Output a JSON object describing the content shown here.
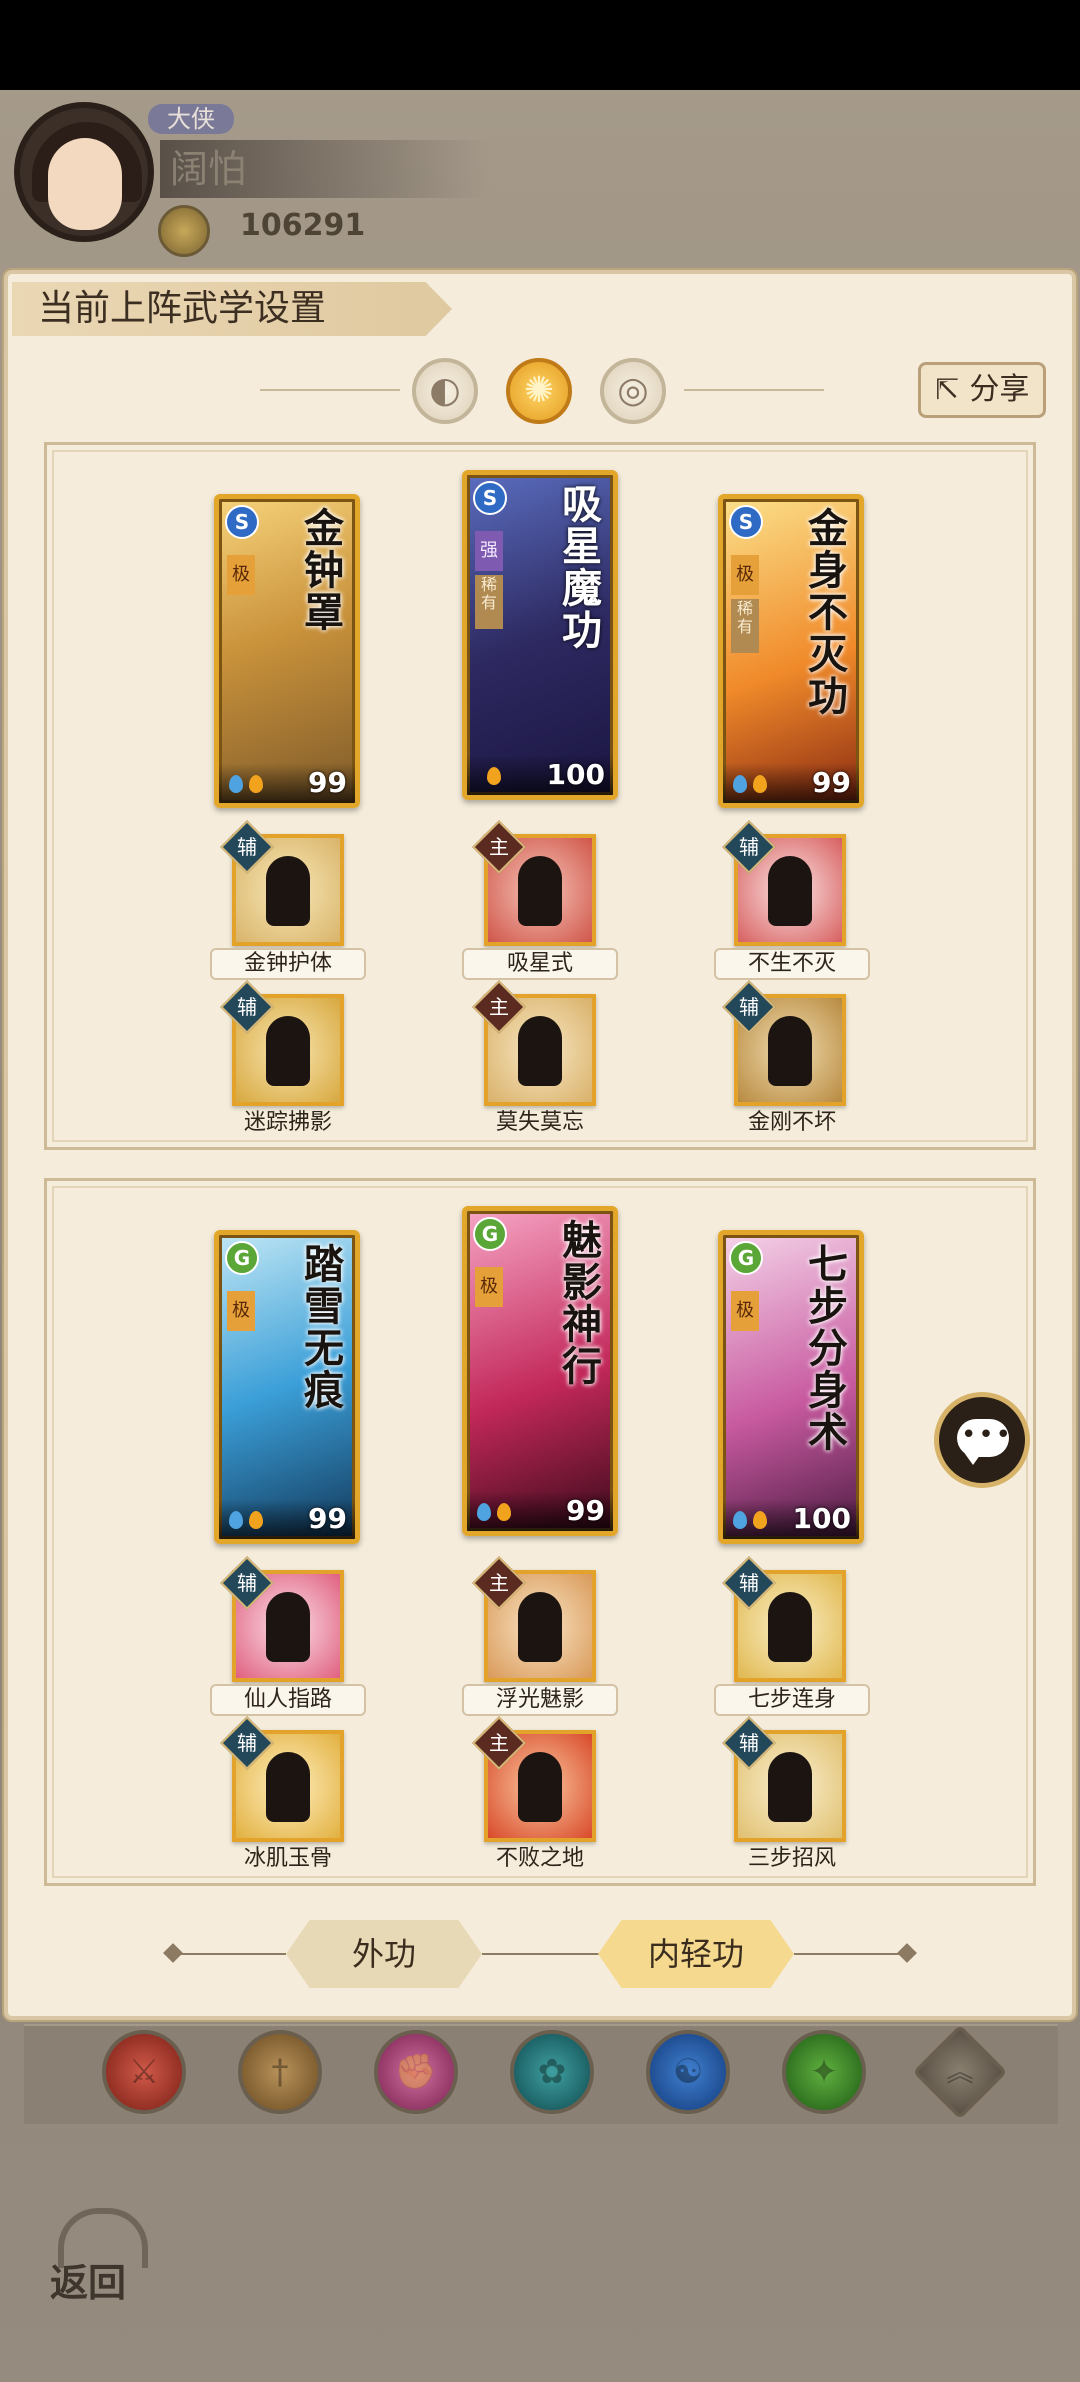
{
  "header": {
    "rank": "大侠",
    "player_name": "阔怕",
    "coins": "106291"
  },
  "panel": {
    "title": "当前上阵武学设置",
    "share_label": "分享"
  },
  "modes": [
    {
      "icon": "moon-icon"
    },
    {
      "icon": "sun-icon"
    },
    {
      "icon": "ring-icon"
    }
  ],
  "group1": {
    "cards": [
      {
        "name": "金钟罩",
        "value": "99",
        "type_icon": "S",
        "rarity": "极"
      },
      {
        "name": "吸星魔功",
        "value": "100",
        "type_icon": "S",
        "rarity": "强",
        "tag": "稀有"
      },
      {
        "name": "金身不灭功",
        "value": "99",
        "type_icon": "S",
        "rarity": "极",
        "tag": "稀有"
      }
    ],
    "row1": [
      {
        "name": "金钟护体",
        "badge": "辅"
      },
      {
        "name": "吸星式",
        "badge": "主"
      },
      {
        "name": "不生不灭",
        "badge": "辅"
      }
    ],
    "row2": [
      {
        "name": "迷踪拂影",
        "badge": "辅"
      },
      {
        "name": "莫失莫忘",
        "badge": "主"
      },
      {
        "name": "金刚不坏",
        "badge": "辅"
      }
    ]
  },
  "group2": {
    "cards": [
      {
        "name": "踏雪无痕",
        "value": "99",
        "type_icon": "G",
        "rarity": "极"
      },
      {
        "name": "魅影神行",
        "value": "99",
        "type_icon": "G",
        "rarity": "极"
      },
      {
        "name": "七步分身术",
        "value": "100",
        "type_icon": "G",
        "rarity": "极"
      }
    ],
    "row1": [
      {
        "name": "仙人指路",
        "badge": "辅"
      },
      {
        "name": "浮光魅影",
        "badge": "主"
      },
      {
        "name": "七步连身",
        "badge": "辅"
      }
    ],
    "row2": [
      {
        "name": "冰肌玉骨",
        "badge": "辅"
      },
      {
        "name": "不败之地",
        "badge": "主"
      },
      {
        "name": "三步招风",
        "badge": "辅"
      }
    ]
  },
  "tabs": {
    "outer": "外功",
    "inner": "内轻功"
  },
  "back_label": "返回",
  "colors": {
    "accent_gold": "#e2a72a",
    "panel_bg": "#f5ecdb",
    "aux_badge": "#23485a",
    "main_badge": "#5b2a20"
  }
}
